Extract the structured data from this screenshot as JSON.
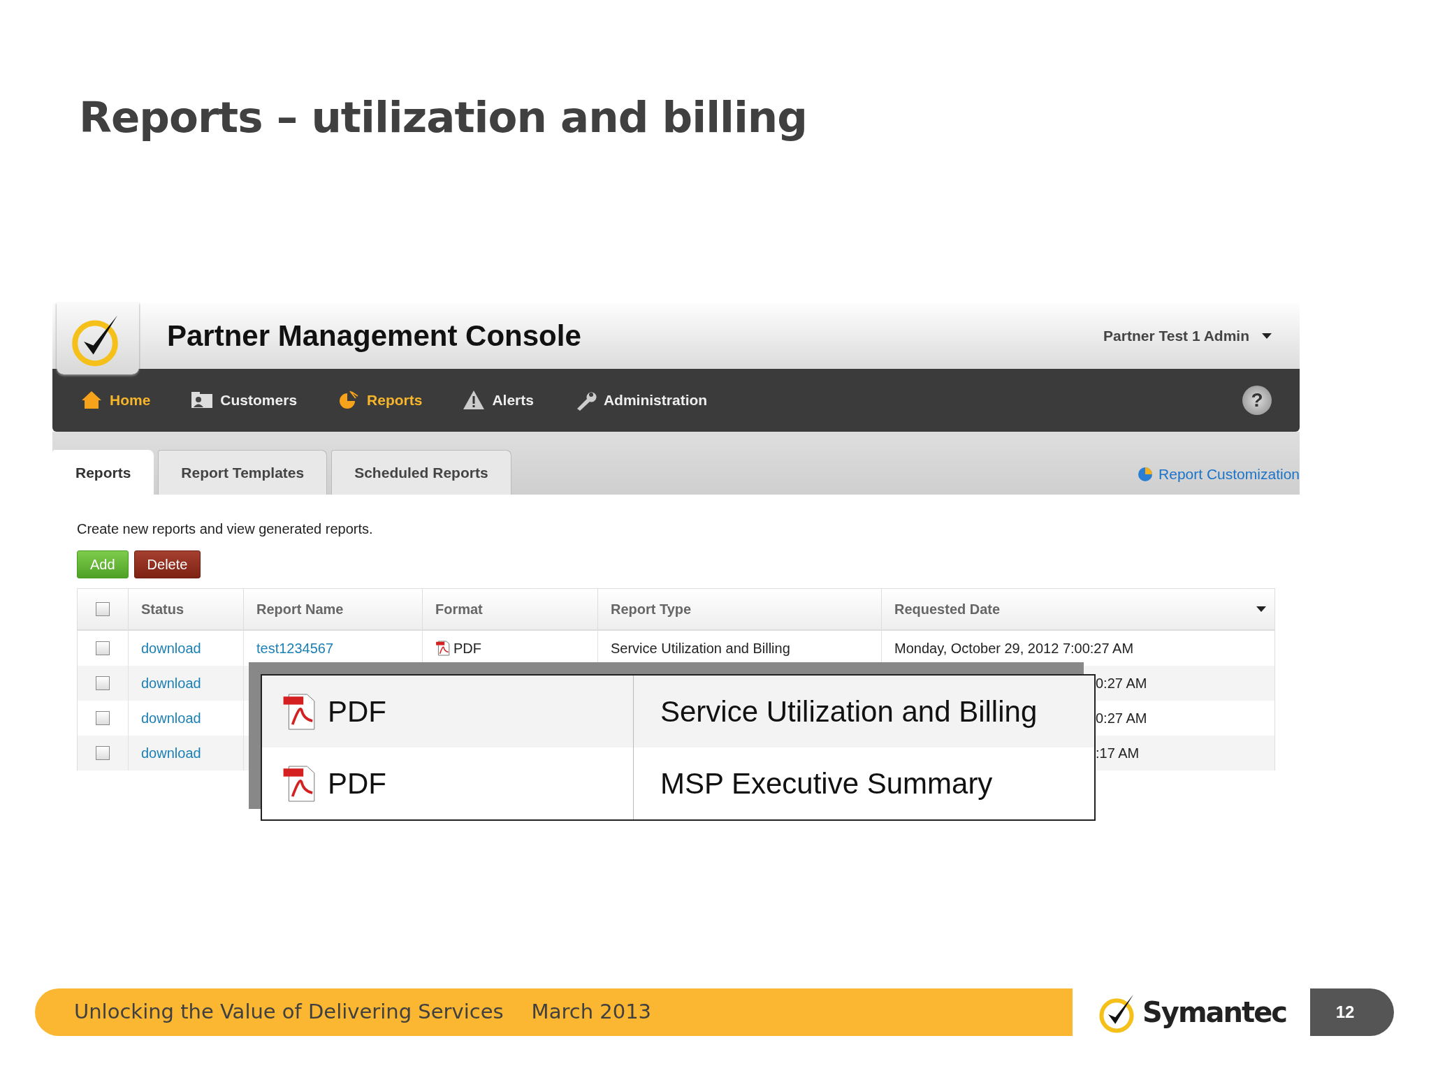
{
  "slide_title": "Reports – utilization and billing",
  "console": {
    "title": "Partner Management Console",
    "user_menu": "Partner Test 1 Admin",
    "nav": [
      {
        "label": "Home",
        "highlighted": true
      },
      {
        "label": "Customers",
        "highlighted": false
      },
      {
        "label": "Reports",
        "highlighted": true
      },
      {
        "label": "Alerts",
        "highlighted": false
      },
      {
        "label": "Administration",
        "highlighted": false
      }
    ],
    "help": "?",
    "tabs": [
      {
        "label": "Reports",
        "selected": true
      },
      {
        "label": "Report Templates",
        "selected": false
      },
      {
        "label": "Scheduled Reports",
        "selected": false
      }
    ],
    "customization_link": "Report Customization",
    "description": "Create new reports and view generated reports.",
    "buttons": [
      {
        "label": "Add",
        "kind": "add"
      },
      {
        "label": "Delete",
        "kind": "delete"
      }
    ],
    "table": {
      "select_all_checked": false,
      "columns": [
        "Status",
        "Report Name",
        "Format",
        "Report Type",
        "Requested Date"
      ],
      "rows": [
        {
          "checked": false,
          "status": "download",
          "report_name": "test1234567",
          "format": "PDF",
          "report_type": "Service Utilization and Billing",
          "requested_date": "Monday, October 29, 2012 7:00:27 AM"
        },
        {
          "checked": false,
          "status": "download",
          "requested_date": "0:27 AM"
        },
        {
          "checked": false,
          "status": "download",
          "requested_date": "0:27 AM"
        },
        {
          "checked": false,
          "status": "download",
          "requested_date": ":17 AM"
        }
      ]
    },
    "zoom_callout": [
      {
        "format": "PDF",
        "report_type": "Service Utilization and Billing"
      },
      {
        "format": "PDF",
        "report_type": "MSP Executive Summary"
      }
    ]
  },
  "footer": {
    "text": "Unlocking the Value of Delivering Services",
    "date": "March 2013",
    "brand": "Symantec",
    "page": "12"
  }
}
